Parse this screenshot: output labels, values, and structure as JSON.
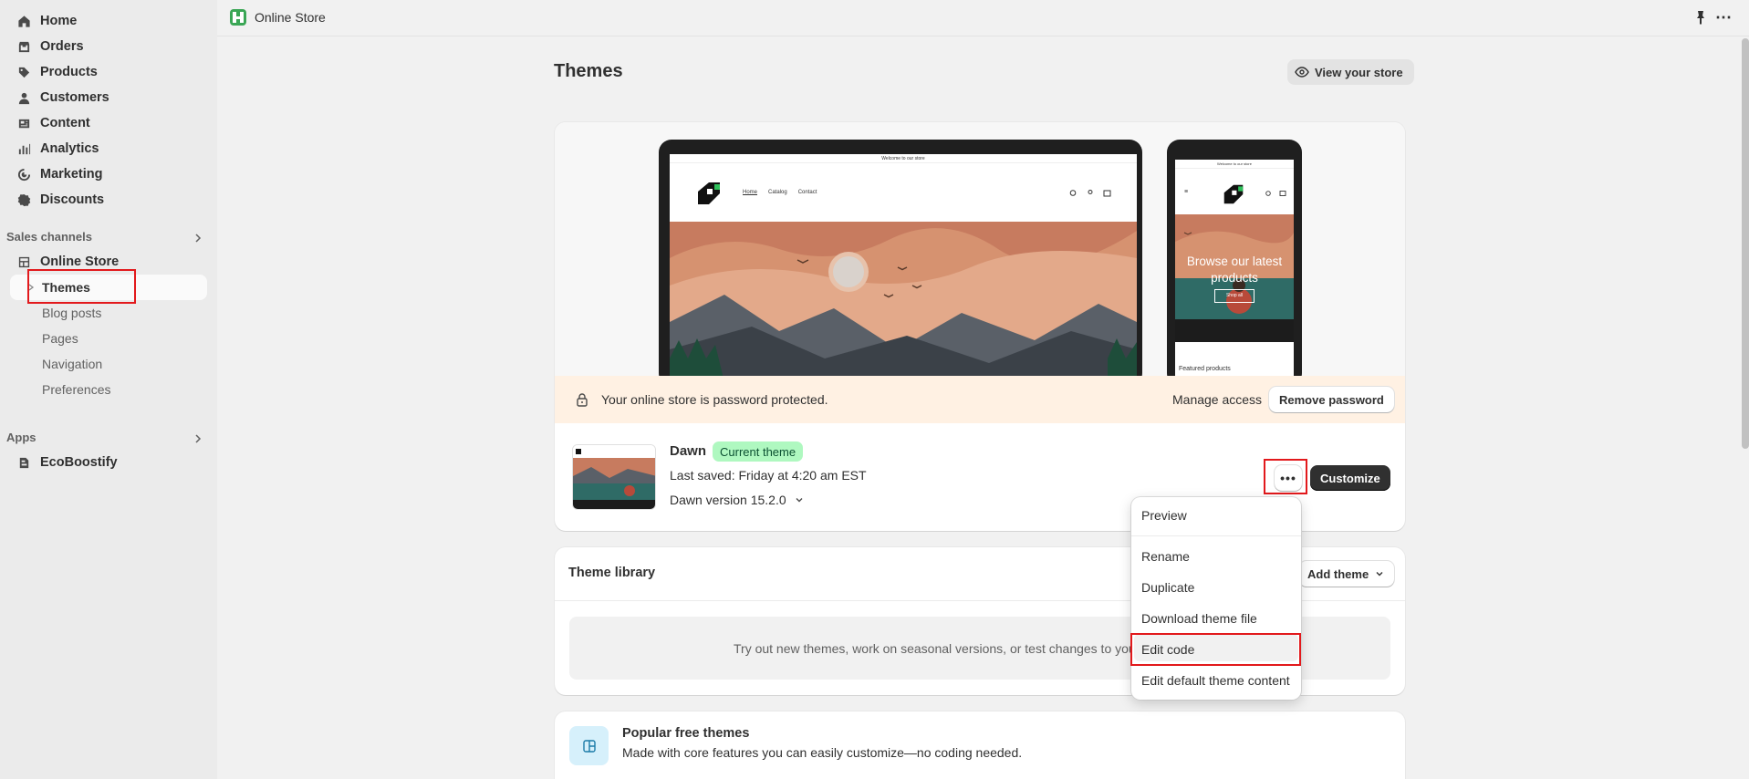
{
  "sidebar": {
    "nav": [
      {
        "label": "Home",
        "icon": "home-icon"
      },
      {
        "label": "Orders",
        "icon": "orders-icon"
      },
      {
        "label": "Products",
        "icon": "tag-icon"
      },
      {
        "label": "Customers",
        "icon": "person-icon"
      },
      {
        "label": "Content",
        "icon": "content-icon"
      },
      {
        "label": "Analytics",
        "icon": "chart-icon"
      },
      {
        "label": "Marketing",
        "icon": "target-icon"
      },
      {
        "label": "Discounts",
        "icon": "discount-icon"
      }
    ],
    "sales_channels_label": "Sales channels",
    "online_store_label": "Online Store",
    "sub_items": [
      "Themes",
      "Blog posts",
      "Pages",
      "Navigation",
      "Preferences"
    ],
    "apps_label": "Apps",
    "app_item_label": "EcoBoostify"
  },
  "topbar": {
    "title": "Online Store"
  },
  "page": {
    "title": "Themes",
    "view_store_label": "View your store"
  },
  "preview": {
    "laptop_announcement": "Welcome to our store",
    "laptop_nav": [
      "Home",
      "Catalog",
      "Contact"
    ],
    "phone_announcement": "Welcome to our store",
    "phone_hero_text": "Browse our latest products",
    "phone_hero_button": "Shop all",
    "phone_featured": "Featured products"
  },
  "password_banner": {
    "text": "Your online store is password protected.",
    "manage_label": "Manage access",
    "remove_label": "Remove password"
  },
  "current_theme": {
    "name": "Dawn",
    "badge": "Current theme",
    "last_saved": "Last saved: Friday at 4:20 am EST",
    "version": "Dawn version 15.2.0",
    "more_label": "•••",
    "customize_label": "Customize"
  },
  "dropdown": {
    "items": [
      "Preview",
      "Rename",
      "Duplicate",
      "Download theme file",
      "Edit code",
      "Edit default theme content"
    ]
  },
  "library": {
    "title": "Theme library",
    "add_label": "Add theme",
    "empty_text": "Try out new themes, work on seasonal versions, or test changes to your"
  },
  "popular": {
    "title": "Popular free themes",
    "subtitle": "Made with core features you can easily customize—no coding needed."
  },
  "colors": {
    "highlight": "#e2191c",
    "badge_bg": "#aff8c0",
    "banner_bg": "#fff1e3",
    "primary_button": "#303030"
  }
}
